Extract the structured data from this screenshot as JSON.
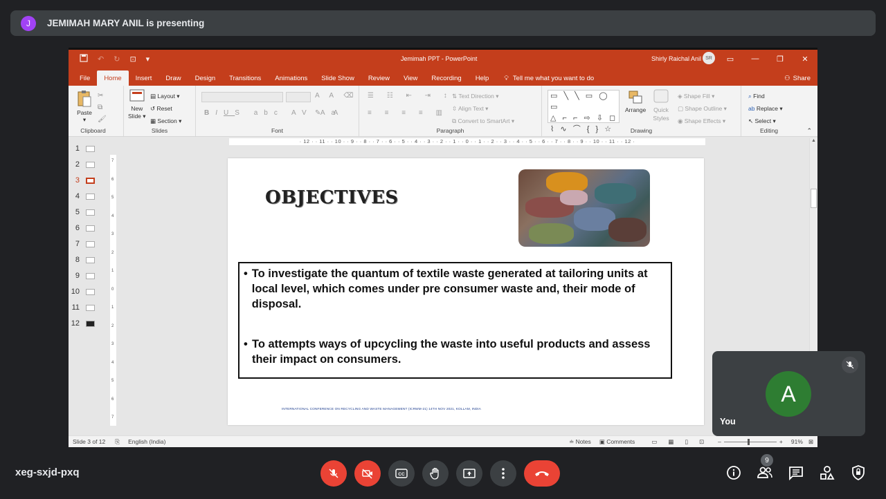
{
  "meet": {
    "presenter": {
      "avatar_letter": "J",
      "avatar_color": "#a142f4",
      "text": "JEMIMAH MARY ANIL is presenting"
    },
    "meeting_code": "xeg-sxjd-pxq",
    "self": {
      "avatar_letter": "A",
      "avatar_color": "#2e7d32",
      "name": "You"
    },
    "people_count": "9",
    "controls": [
      "mic-off-icon",
      "camera-off-icon",
      "captions-icon",
      "raise-hand-icon",
      "present-icon",
      "more-options-icon",
      "end-call-icon"
    ],
    "right_icons": [
      "info-icon",
      "people-icon",
      "chat-icon",
      "activities-icon",
      "host-controls-icon"
    ]
  },
  "ppt": {
    "window_title": "Jemimah PPT  -  PowerPoint",
    "user_name": "Shirly Raichal Anil",
    "user_initials": "SR",
    "accent_color": "#c43e1c",
    "tabs": [
      "File",
      "Home",
      "Insert",
      "Draw",
      "Design",
      "Transitions",
      "Animations",
      "Slide Show",
      "Review",
      "View",
      "Recording",
      "Help"
    ],
    "active_tab": "Home",
    "tell_me": "Tell me what you want to do",
    "share": "Share",
    "groups": {
      "clipboard": {
        "label": "Clipboard",
        "paste": "Paste"
      },
      "slides": {
        "label": "Slides",
        "new_slide_1": "New",
        "new_slide_2": "Slide",
        "layout": "Layout",
        "reset": "Reset",
        "section": "Section"
      },
      "font": {
        "label": "Font"
      },
      "paragraph": {
        "label": "Paragraph",
        "text_direction": "Text Direction",
        "align_text": "Align Text",
        "convert_smartart": "Convert to SmartArt"
      },
      "drawing": {
        "label": "Drawing",
        "arrange": "Arrange",
        "quick_styles_1": "Quick",
        "quick_styles_2": "Styles",
        "shape_fill": "Shape Fill",
        "shape_outline": "Shape Outline",
        "shape_effects": "Shape Effects"
      },
      "editing": {
        "label": "Editing",
        "find": "Find",
        "replace": "Replace",
        "select": "Select"
      }
    },
    "ruler_top": "· 12 · · 11 · · 10 · · 9 · · 8 · · 7 · · 6 · · 5 · · 4 · · 3 · · 2 · · 1 · · 0 · · 1 · · 2 · · 3 · · 4 · · 5 · · 6 · · 7 · · 8 · · 9 · · 10 · · 11 · · 12 ·",
    "ruler_left": [
      "7",
      "6",
      "5",
      "4",
      "3",
      "2",
      "1",
      "0",
      "1",
      "2",
      "3",
      "4",
      "5",
      "6",
      "7"
    ],
    "thumbnails": [
      "1",
      "2",
      "3",
      "4",
      "5",
      "6",
      "7",
      "8",
      "9",
      "10",
      "11",
      "12"
    ],
    "active_slide": "3",
    "slide": {
      "title": "OBJECTIVES",
      "bullet_1": "To investigate the quantum of textile waste generated at tailoring units at local level, which comes under pre consumer waste and, their mode of disposal.",
      "bullet_2": "To  attempts ways of  upcycling the waste into useful products and assess their impact on consumers.",
      "footer": "INTERNATIONAL CONFERENCE ON RECYCLING AND WASTE MANAGEMENT (ICRWM-21) 14TH NOV 2021, KOLLAM, INDIA"
    },
    "status": {
      "slide_of": "Slide 3 of 12",
      "language": "English (India)",
      "notes": "Notes",
      "comments": "Comments",
      "zoom": "91%"
    }
  }
}
